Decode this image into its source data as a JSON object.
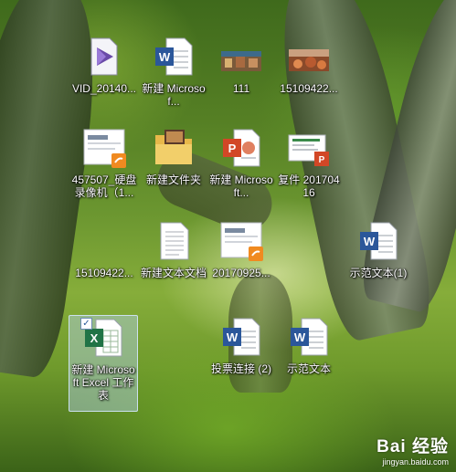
{
  "desktop": {
    "icons": [
      {
        "label": "VID_20140...",
        "icon": "video-file-icon"
      },
      {
        "label": "新建 Microsof...",
        "icon": "word-doc-icon"
      },
      {
        "label": "111",
        "icon": "image-thumbnail-icon"
      },
      {
        "label": "15109422...",
        "icon": "image-thumbnail-icon"
      },
      {
        "label": "457507_硬盘录像机（1...",
        "icon": "video-recorder-shortcut-icon"
      },
      {
        "label": "新建文件夹",
        "icon": "folder-icon"
      },
      {
        "label": "新建 Microsoft...",
        "icon": "powerpoint-doc-icon"
      },
      {
        "label": "复件 20170416",
        "icon": "powerpoint-doc-icon"
      },
      {
        "label": "15109422...",
        "icon": "blank-file-icon"
      },
      {
        "label": "新建文本文档",
        "icon": "text-file-icon"
      },
      {
        "label": "20170925...",
        "icon": "shortcut-document-icon"
      },
      {
        "label": "示范文本(1)",
        "icon": "word-doc-icon"
      },
      {
        "label": "新建 Microsoft Excel 工作表",
        "icon": "excel-doc-icon"
      },
      {
        "label": "投票连接 (2)",
        "icon": "word-doc-icon"
      },
      {
        "label": "示范文本",
        "icon": "word-doc-icon"
      }
    ]
  },
  "watermark": {
    "brand": "Bai  经验",
    "url": "jingyan.baidu.com"
  },
  "colors": {
    "word": "#2b579a",
    "excel": "#217346",
    "powerpoint": "#d24726",
    "selection": "#b4d2f0"
  }
}
